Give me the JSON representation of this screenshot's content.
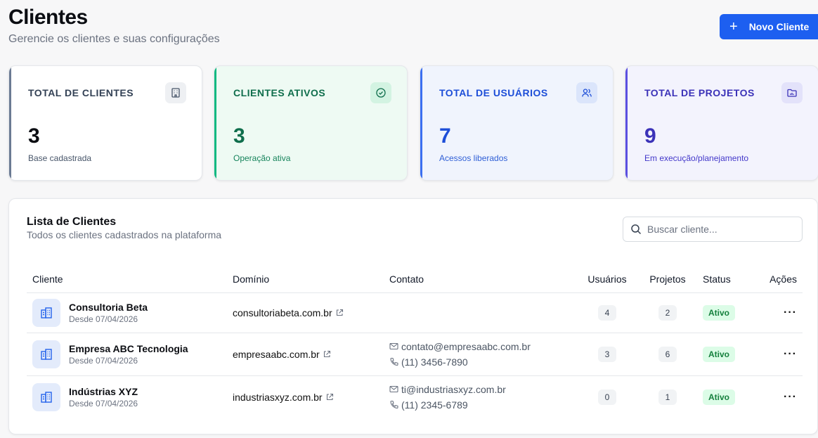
{
  "header": {
    "title": "Clientes",
    "subtitle": "Gerencie os clientes e suas configurações",
    "new_button_label": "Novo Cliente"
  },
  "stats": [
    {
      "label": "TOTAL DE CLIENTES",
      "value": "3",
      "description": "Base cadastrada",
      "icon": "building-icon"
    },
    {
      "label": "CLIENTES ATIVOS",
      "value": "3",
      "description": "Operação ativa",
      "icon": "check-circle-icon"
    },
    {
      "label": "TOTAL DE USUÁRIOS",
      "value": "7",
      "description": "Acessos liberados",
      "icon": "users-icon"
    },
    {
      "label": "TOTAL DE PROJETOS",
      "value": "9",
      "description": "Em execução/planejamento",
      "icon": "folder-chart-icon"
    }
  ],
  "list": {
    "title": "Lista de Clientes",
    "subtitle": "Todos os clientes cadastrados na plataforma",
    "search_placeholder": "Buscar cliente...",
    "columns": [
      "Cliente",
      "Domínio",
      "Contato",
      "Usuários",
      "Projetos",
      "Status",
      "Ações"
    ],
    "rows": [
      {
        "name": "Consultoria Beta",
        "since": "Desde 07/04/2026",
        "domain": "consultoriabeta.com.br",
        "email": "",
        "phone": "",
        "users": "4",
        "projects": "2",
        "status": "Ativo"
      },
      {
        "name": "Empresa ABC Tecnologia",
        "since": "Desde 07/04/2026",
        "domain": "empresaabc.com.br",
        "email": "contato@empresaabc.com.br",
        "phone": "(11) 3456-7890",
        "users": "3",
        "projects": "6",
        "status": "Ativo"
      },
      {
        "name": "Indústrias XYZ",
        "since": "Desde 07/04/2026",
        "domain": "industriasxyz.com.br",
        "email": "ti@industriasxyz.com.br",
        "phone": "(11) 2345-6789",
        "users": "0",
        "projects": "1",
        "status": "Ativo"
      }
    ],
    "more_glyph": "···"
  },
  "colors": {
    "primary": "#1d5ff0",
    "active_green": "#10b981",
    "users_blue": "#3b6ff0",
    "projects_indigo": "#5b4fe0",
    "status_bg": "#dcfce7",
    "status_text": "#15803d"
  }
}
